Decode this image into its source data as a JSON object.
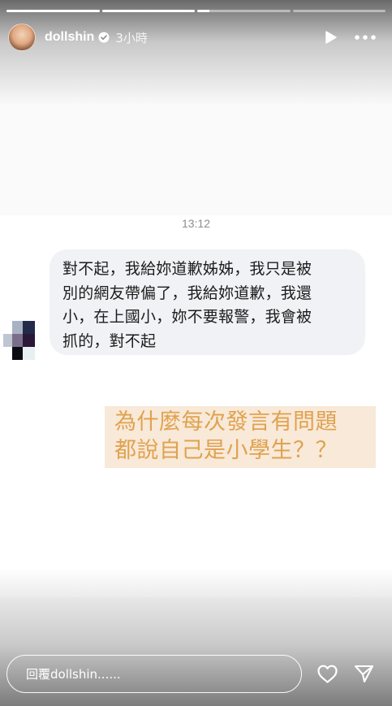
{
  "story": {
    "progress": [
      1.0,
      1.0,
      0.13,
      0.0
    ],
    "header": {
      "username": "dollshin",
      "time_ago": "3小時"
    }
  },
  "chat": {
    "timestamp": "13:12",
    "message_lines": [
      "對不起，我給妳道歉姊姊，我只是被",
      "別的網友帶偏了，我給妳道歉，我還",
      "小，在上國小，妳不要報警，我會被",
      "抓的，對不起"
    ]
  },
  "caption": {
    "lines": [
      "為什麼每次發言有問題",
      "都說自己是小學生？？"
    ]
  },
  "reply": {
    "placeholder": "回覆dollshin......"
  },
  "colors": {
    "caption_text": "#e0a24e",
    "caption_bg": "#f7e7d5",
    "bubble_bg": "#f1f2f6",
    "verified_badge": "#ffffff"
  },
  "icons": {
    "verified": "verified-badge-icon",
    "play": "play-icon",
    "more": "more-horizontal-icon",
    "heart": "heart-icon",
    "send": "send-icon"
  }
}
